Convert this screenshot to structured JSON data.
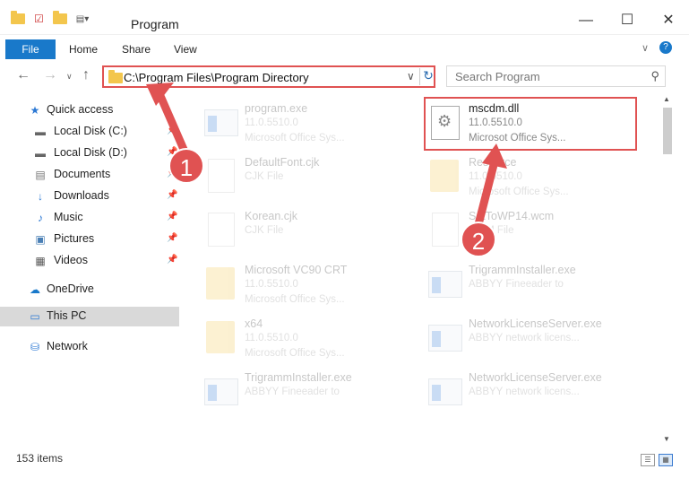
{
  "window": {
    "title": "Program",
    "minimize": "—",
    "maximize": "☐",
    "close": "✕"
  },
  "ribbon": {
    "tabs": [
      "File",
      "Home",
      "Share",
      "View"
    ]
  },
  "nav": {
    "address": "C:\\Program Files\\Program Directory",
    "search_placeholder": "Search Program"
  },
  "sidebar": {
    "items": [
      {
        "label": "Quick access",
        "icon": "star-icon",
        "glyph": "★",
        "pin": false
      },
      {
        "label": "Local Disk (C:)",
        "icon": "drive-icon",
        "glyph": "▬",
        "pin": true
      },
      {
        "label": "Local Disk (D:)",
        "icon": "drive-icon",
        "glyph": "▬",
        "pin": true
      },
      {
        "label": "Documents",
        "icon": "documents-icon",
        "glyph": "▤",
        "pin": true
      },
      {
        "label": "Downloads",
        "icon": "download-icon",
        "glyph": "↓",
        "pin": true
      },
      {
        "label": "Music",
        "icon": "music-icon",
        "glyph": "♪",
        "pin": true
      },
      {
        "label": "Pictures",
        "icon": "pictures-icon",
        "glyph": "▣",
        "pin": true
      },
      {
        "label": "Videos",
        "icon": "videos-icon",
        "glyph": "▦",
        "pin": true
      },
      {
        "label": "OneDrive",
        "icon": "cloud-icon",
        "glyph": "☁",
        "pin": false
      },
      {
        "label": "This PC",
        "icon": "computer-icon",
        "glyph": "▭",
        "pin": false
      },
      {
        "label": "Network",
        "icon": "network-icon",
        "glyph": "⛁",
        "pin": false
      }
    ]
  },
  "files": [
    {
      "name": "program.exe",
      "l2": "11.0.5510.0",
      "l3": "Microsoft Office Sys...",
      "kind": "exe"
    },
    {
      "name": "mscdm.dll",
      "l2": "11.0.5510.0",
      "l3": "Microsot Office Sys...",
      "kind": "dll"
    },
    {
      "name": "DefaultFont.cjk",
      "l2": "CJK File",
      "l3": "",
      "kind": "doc"
    },
    {
      "name": "Resource",
      "l2": "11.0.5510.0",
      "l3": "Microsoft Office Sys...",
      "kind": "folder"
    },
    {
      "name": "Korean.cjk",
      "l2": "CJK File",
      "l3": "",
      "kind": "doc"
    },
    {
      "name": "SetToWP14.wcm",
      "l2": "WCM File",
      "l3": "",
      "kind": "doc"
    },
    {
      "name": "Microsoft VC90 CRT",
      "l2": "11.0.5510.0",
      "l3": "Microsoft Office Sys...",
      "kind": "folder"
    },
    {
      "name": "TrigrammInstaller.exe",
      "l2": "ABBYY Fineeader to",
      "l3": "",
      "kind": "exe"
    },
    {
      "name": "x64",
      "l2": "11.0.5510.0",
      "l3": "Microsoft Office Sys...",
      "kind": "folder"
    },
    {
      "name": "NetworkLicenseServer.exe",
      "l2": "ABBYY network licens...",
      "l3": "",
      "kind": "exe"
    },
    {
      "name": "TrigrammInstaller.exe",
      "l2": "ABBYY Fineeader to",
      "l3": "",
      "kind": "exe"
    },
    {
      "name": "NetworkLicenseServer.exe",
      "l2": "ABBYY network licens...",
      "l3": "",
      "kind": "exe"
    }
  ],
  "status": {
    "items_count": "153 items"
  },
  "annotations": {
    "step1": "1",
    "step2": "2",
    "color": "#e05252"
  }
}
